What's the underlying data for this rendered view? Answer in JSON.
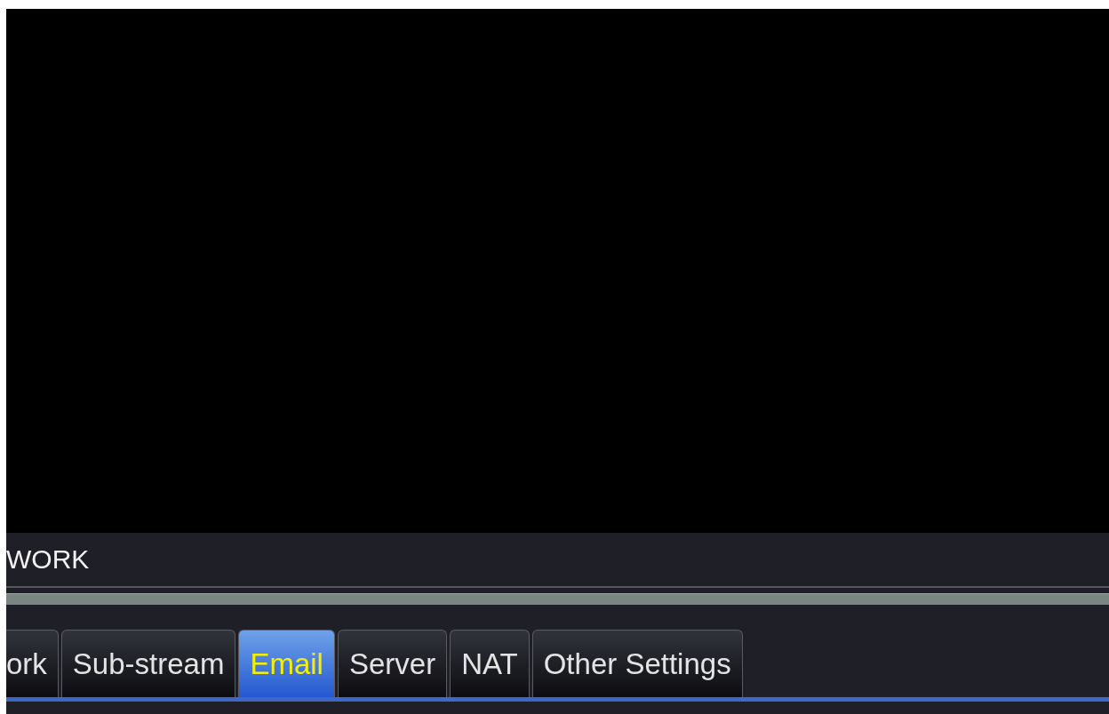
{
  "window": {
    "title": "WORK"
  },
  "tabs": [
    {
      "label": "ork",
      "selected": false
    },
    {
      "label": "Sub-stream",
      "selected": false
    },
    {
      "label": "Email",
      "selected": true
    },
    {
      "label": "Server",
      "selected": false
    },
    {
      "label": "NAT",
      "selected": false
    },
    {
      "label": "Other Settings",
      "selected": false
    }
  ]
}
